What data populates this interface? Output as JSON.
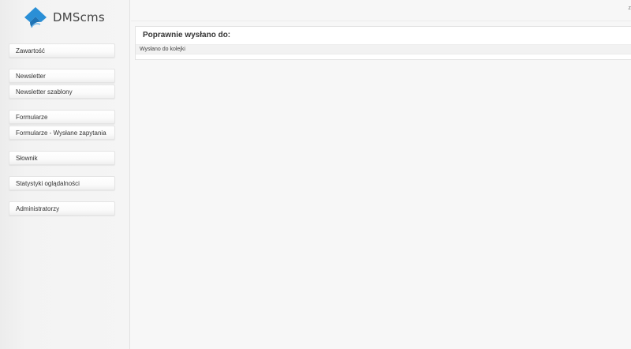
{
  "app": {
    "name": "DMScms",
    "brand_color": "#2a8fd6"
  },
  "topbar": {
    "right_text": "z"
  },
  "sidebar": {
    "items": [
      {
        "label": "Zawartość"
      },
      {
        "label": "Newsletter"
      },
      {
        "label": "Newsletter szablony"
      },
      {
        "label": "Formularze"
      },
      {
        "label": "Formularze - Wysłane zapytania"
      },
      {
        "label": "Słownik"
      },
      {
        "label": "Statystyki oglądalności"
      },
      {
        "label": "Administratorzy"
      }
    ]
  },
  "main": {
    "panel_title": "Poprawnie wysłano do:",
    "status_message": "Wysłano do kolejki"
  }
}
